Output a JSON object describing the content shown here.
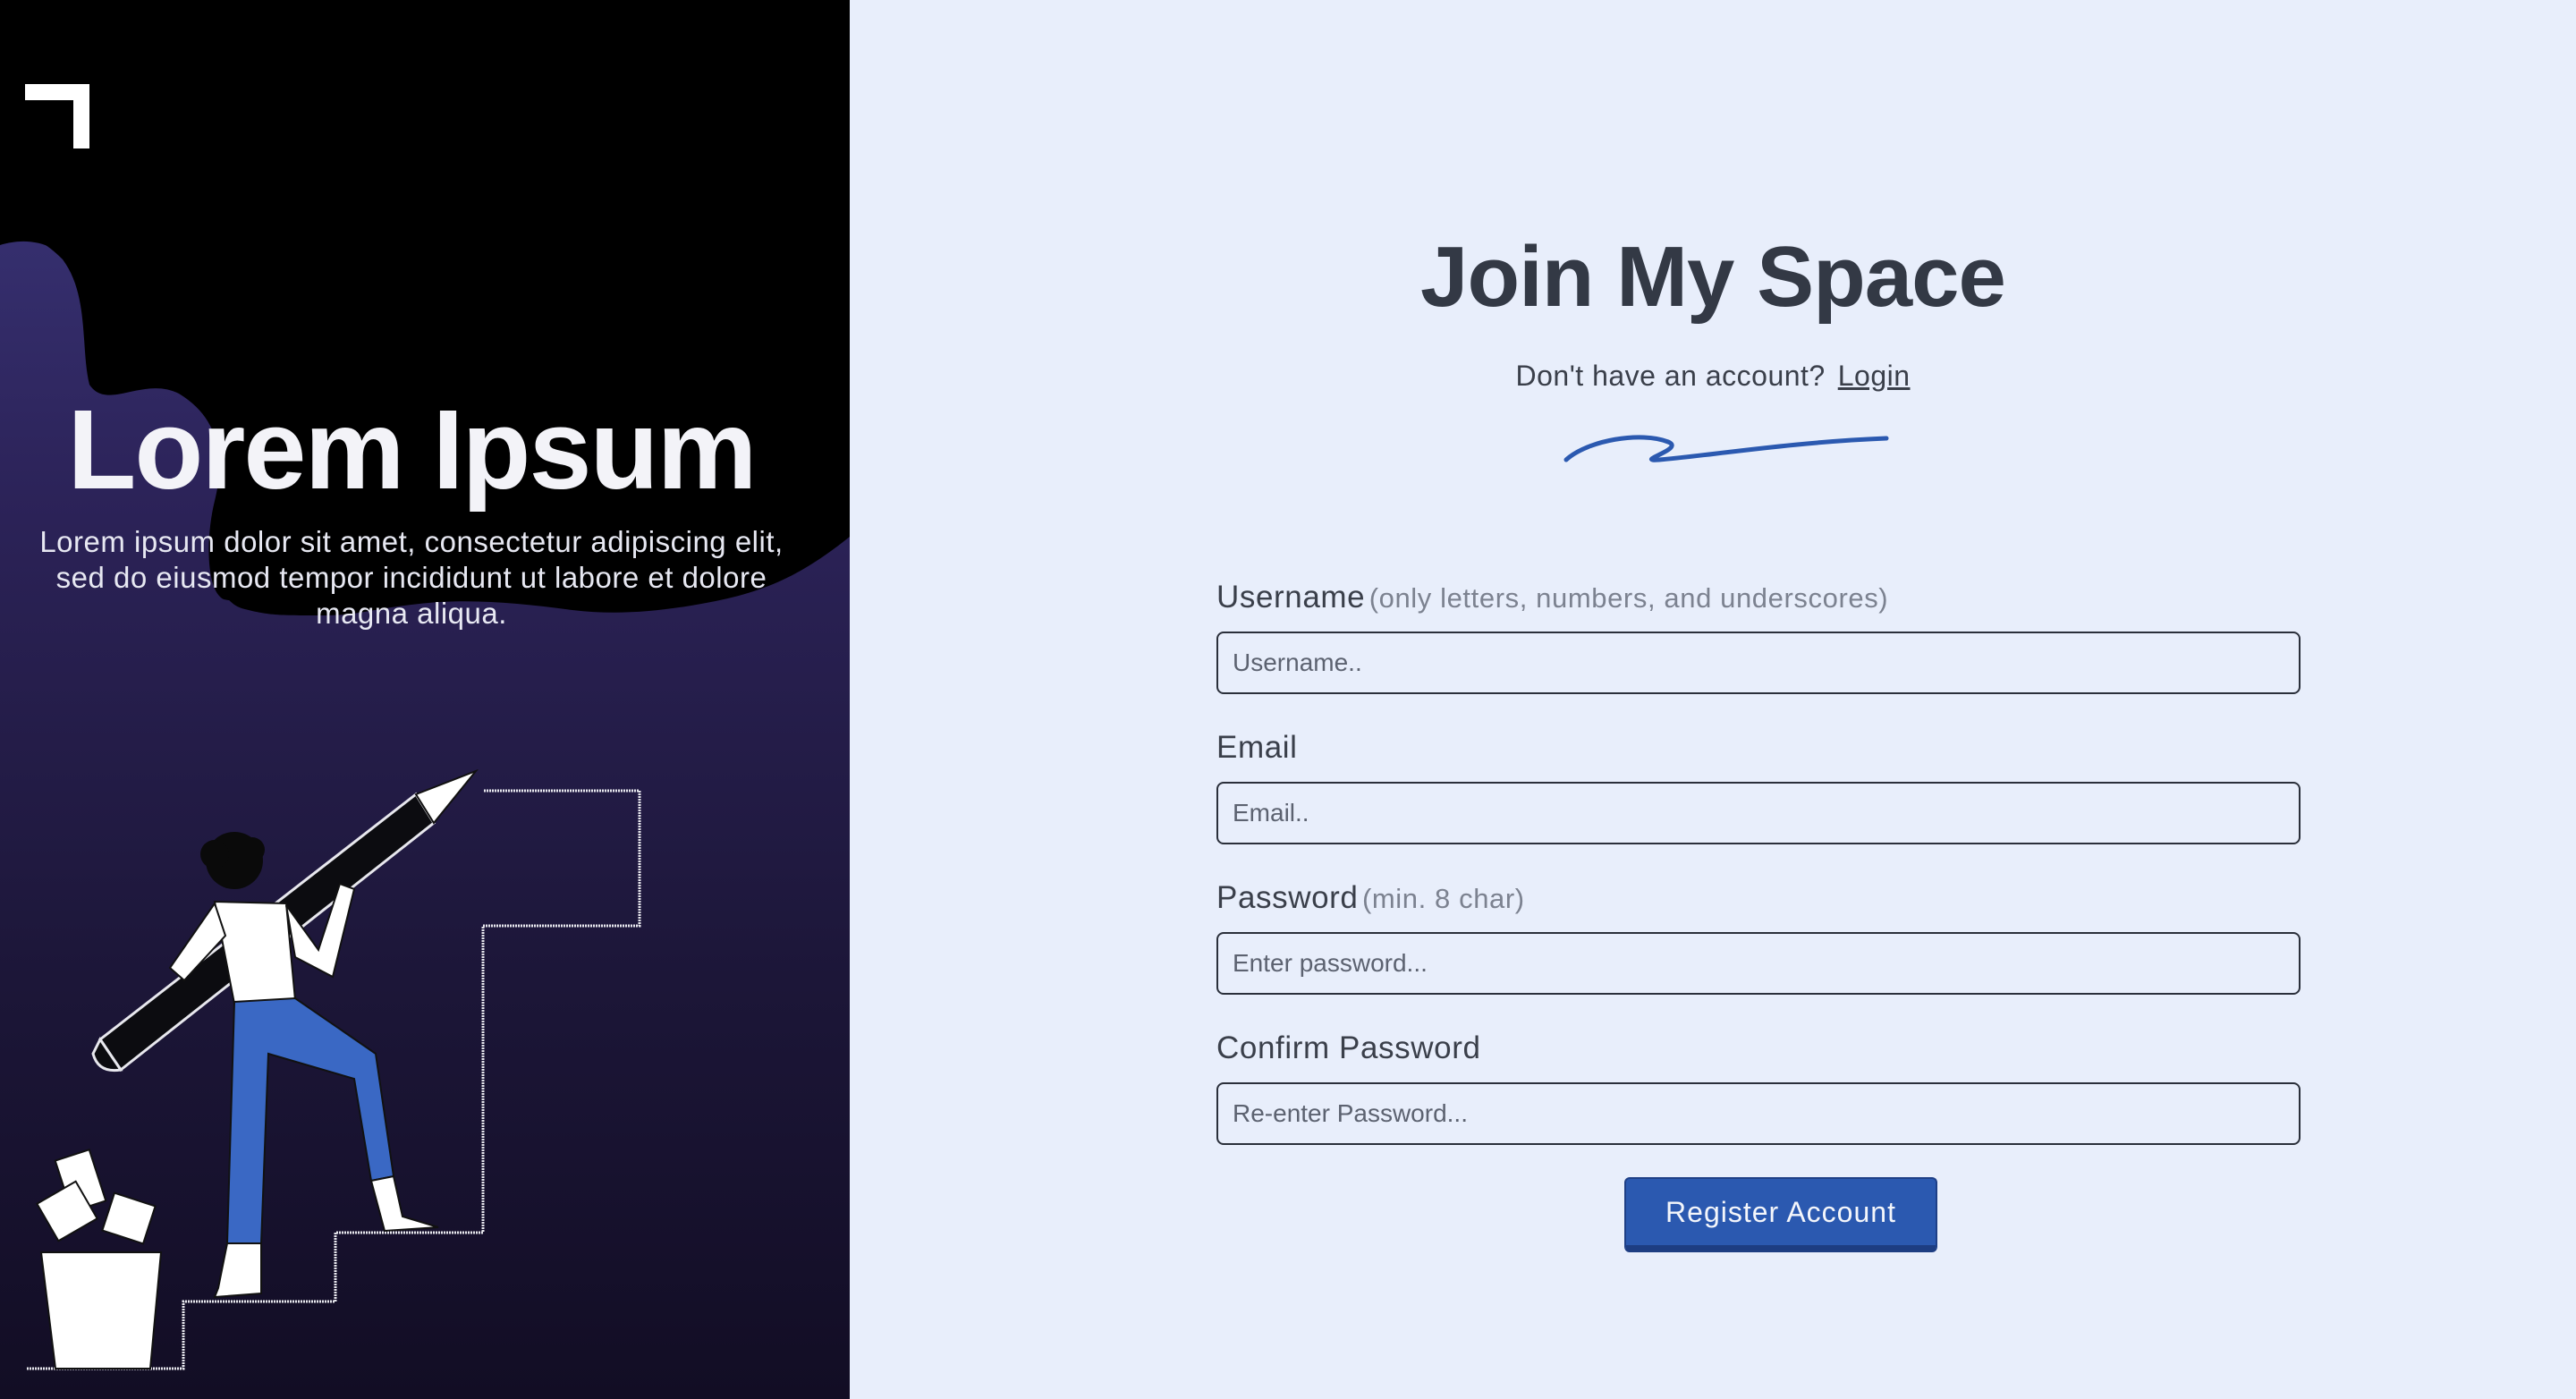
{
  "hero": {
    "title": "Lorem Ipsum",
    "text": "Lorem ipsum dolor sit amet, consectetur adipiscing elit, sed do eiusmod tempor incididunt ut labore et dolore magna aliqua."
  },
  "form": {
    "title": "Join My Space",
    "login_prompt": "Don't have an account?",
    "login_link": "Login",
    "username": {
      "label": "Username",
      "hint": "(only letters, numbers, and underscores)",
      "placeholder": "Username.."
    },
    "email": {
      "label": "Email",
      "placeholder": "Email.."
    },
    "password": {
      "label": "Password",
      "hint": "(min. 8 char)",
      "placeholder": "Enter password..."
    },
    "confirm": {
      "label": "Confirm Password",
      "placeholder": "Re-enter Password..."
    },
    "submit_label": "Register Account"
  },
  "icons": {
    "logo": "corner-bracket-logo-icon",
    "squiggle": "signature-squiggle-icon",
    "illustration": "person-carrying-pencil-up-stairs-illustration"
  },
  "colors": {
    "accent": "#2b59b0",
    "right_background": "#e8eefb",
    "heading_text": "#333945",
    "left_gradient_top": "#3e3a82",
    "left_gradient_bottom": "#120d24"
  }
}
